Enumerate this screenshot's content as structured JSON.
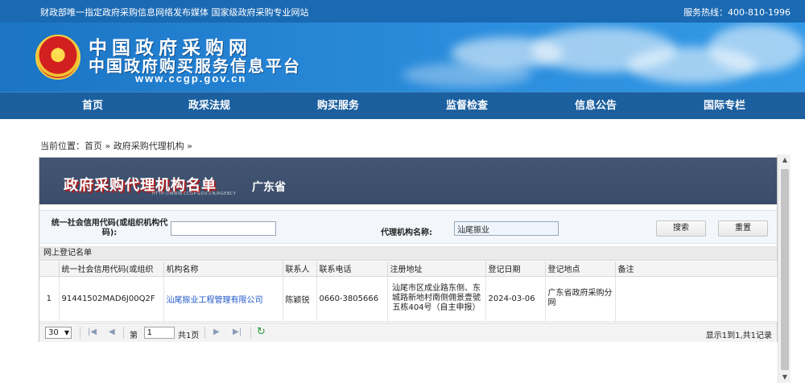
{
  "topbar": {
    "slogan": "财政部唯一指定政府采购信息网络发布媒体 国家级政府采购专业网站",
    "hotline": "服务热线：400-810-1996"
  },
  "brand": {
    "name": "中国政府采购网",
    "subtitle": "中国政府购买服务信息平台",
    "url": "www.ccgp.gov.cn"
  },
  "nav": [
    "首页",
    "政采法规",
    "购买服务",
    "监督检查",
    "信息公告",
    "国际专栏"
  ],
  "breadcrumb": {
    "prefix": "当前位置：",
    "home": "首页",
    "sep": " » ",
    "current": "政府采购代理机构",
    "tail": " »"
  },
  "panel": {
    "title": "政府采购代理机构名单",
    "province": "广东省",
    "small_url": "HTTP://WWW.CCGP.GOV.CN/AGENCY"
  },
  "search": {
    "credit_label": "统一社会信用代码(或组织机构代码):",
    "credit_value": "",
    "name_label": "代理机构名称:",
    "name_value": "汕尾振业",
    "search_btn": "搜索",
    "reset_btn": "重置"
  },
  "list_title": "网上登记名单",
  "table": {
    "columns": [
      "统一社会信用代码(或组织",
      "机构名称",
      "联系人",
      "联系电话",
      "注册地址",
      "登记日期",
      "登记地点",
      "备注"
    ],
    "rows": [
      {
        "index": "1",
        "credit": "91441502MAD6J00Q2F",
        "name": "汕尾振业工程管理有限公司",
        "contact": "陈颖锐",
        "phone": "0660-3805666",
        "address": "汕尾市区成业路东侧、东城路新地村南侧佣景壹號五栋404号（自主申报）",
        "date": "2024-03-06",
        "place": "广东省政府采购分网",
        "note": ""
      }
    ]
  },
  "pager": {
    "page_size": "30",
    "page_label": "第",
    "page_value": "1",
    "total_pages": "共1页",
    "info": "显示1到1,共1记录"
  }
}
